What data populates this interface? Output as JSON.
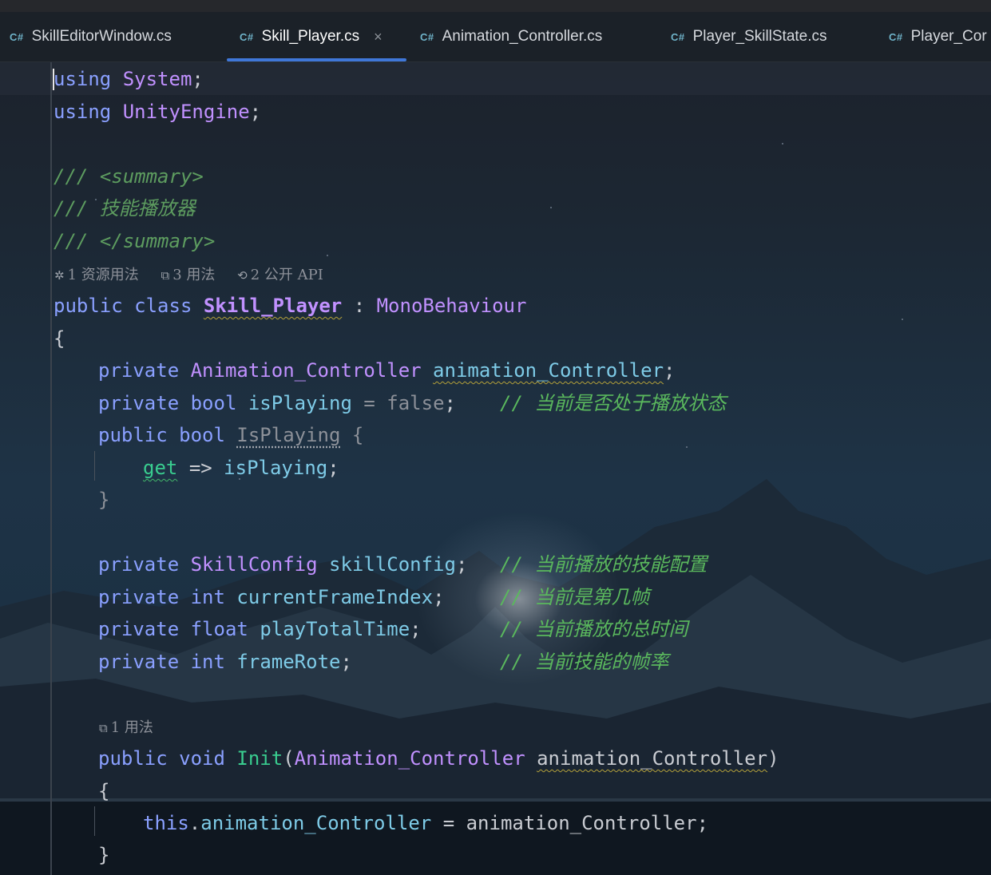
{
  "tabs": [
    {
      "badge": "C#",
      "label": "SkillEditorWindow.cs",
      "active": false
    },
    {
      "badge": "C#",
      "label": "Skill_Player.cs",
      "active": true,
      "close": "×"
    },
    {
      "badge": "C#",
      "label": "Animation_Controller.cs",
      "active": false
    },
    {
      "badge": "C#",
      "label": "Player_SkillState.cs",
      "active": false
    },
    {
      "badge": "C#",
      "label": "Player_Cor",
      "active": false
    }
  ],
  "code": {
    "l1": {
      "kw": "using",
      "ns": "System",
      "end": ";"
    },
    "l2": {
      "kw": "using",
      "ns": "UnityEngine",
      "end": ";"
    },
    "l4": {
      "slashes": "///",
      "tag": "<summary>"
    },
    "l5": {
      "slashes": "///",
      "text": "技能播放器"
    },
    "l6": {
      "slashes": "///",
      "tag": "</summary>"
    },
    "hint1": {
      "a": "1 资源用法",
      "b": "3 用法",
      "c": "2 公开 API"
    },
    "l7": {
      "kw1": "public",
      "kw2": "class",
      "name": "Skill_Player",
      "colon": ":",
      "base": "MonoBehaviour"
    },
    "l8": "{",
    "l9": {
      "kw": "private",
      "type": "Animation_Controller",
      "field": "animation_Controller",
      "end": ";"
    },
    "l10": {
      "kw": "private",
      "type": "bool",
      "field": "isPlaying",
      "eq": "=",
      "val": "false",
      "end": ";",
      "comment": "// 当前是否处于播放状态"
    },
    "l11": {
      "kw": "public",
      "type": "bool",
      "prop": "IsPlaying",
      "brace": "{"
    },
    "l12": {
      "acc": "get",
      "arrow": "=>",
      "field": "isPlaying",
      "end": ";"
    },
    "l13": "}",
    "l15": {
      "kw": "private",
      "type": "SkillConfig",
      "field": "skillConfig",
      "end": ";",
      "comment": "// 当前播放的技能配置"
    },
    "l16": {
      "kw": "private",
      "type": "int",
      "field": "currentFrameIndex",
      "end": ";",
      "comment": "// 当前是第几帧"
    },
    "l17": {
      "kw": "private",
      "type": "float",
      "field": "playTotalTime",
      "end": ";",
      "comment": "// 当前播放的总时间"
    },
    "l18": {
      "kw": "private",
      "type": "int",
      "field": "frameRote",
      "end": ";",
      "comment": "// 当前技能的帧率"
    },
    "hint2": {
      "a": "1 用法"
    },
    "l20": {
      "kw1": "public",
      "kw2": "void",
      "method": "Init",
      "open": "(",
      "ptype": "Animation_Controller",
      "pname": "animation_Controller",
      "close": ")"
    },
    "l21": "{",
    "l22": {
      "kw": "this",
      "dot": ".",
      "field": "animation_Controller",
      "eq": "=",
      "val": "animation_Controller",
      "end": ";"
    },
    "l23": "}"
  },
  "colors": {
    "keyword": "#8aa0ff",
    "type": "#c191ff",
    "field": "#7ecbe7",
    "method": "#39cc8f",
    "comment": "#5ab85d",
    "doc": "#5d9c5f",
    "tab_underline": "#3f77d8"
  },
  "icons": {
    "tab": "csharp-file-icon",
    "close": "close-icon",
    "hint_resource": "unity-resource-icon",
    "hint_usage": "usage-icon",
    "hint_api": "api-icon"
  }
}
